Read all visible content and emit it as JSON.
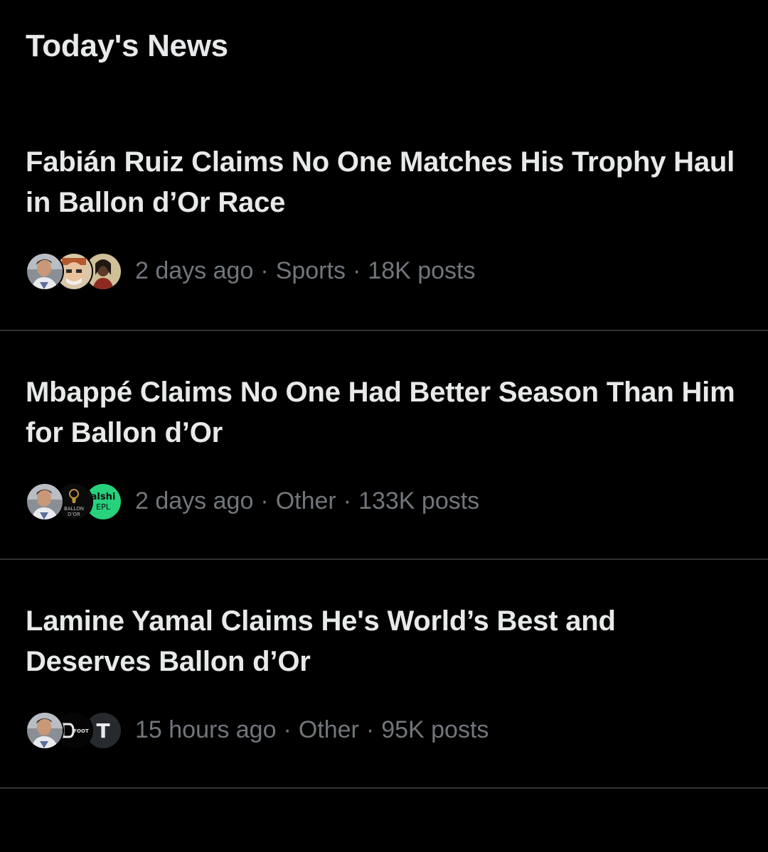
{
  "section": {
    "title": "Today's News"
  },
  "news": [
    {
      "headline": "Fabián Ruiz Claims No One Matches His Trophy Haul in Ballon d’Or Race",
      "time": "2 days ago",
      "category": "Sports",
      "posts": "18K posts",
      "avatars": [
        "man-avatar",
        "painted-portrait-avatar",
        "woman-avatar"
      ]
    },
    {
      "headline": "Mbappé Claims No One Had Better Season Than Him for Ballon d’Or",
      "time": "2 days ago",
      "category": "Other",
      "posts": "133K posts",
      "avatars": [
        "man-avatar",
        "ballon-dor-avatar",
        "kalshi-epl-avatar"
      ],
      "avatar_text": {
        "ballon": "BALLON",
        "dor": "D'OR",
        "kalshi": "alshi",
        "epl": "EPL"
      }
    },
    {
      "headline": "Lamine Yamal Claims He's World’s Best and Deserves Ballon d’Or",
      "time": "15 hours ago",
      "category": "Other",
      "posts": "95K posts",
      "avatars": [
        "man-avatar",
        "foot-logo-avatar",
        "t-logo-avatar"
      ],
      "avatar_text": {
        "foot": "FOOT",
        "t": "T"
      }
    }
  ],
  "separator": "·",
  "colors": {
    "background": "#000000",
    "text_primary": "#e7e9ea",
    "text_secondary": "#71767b",
    "divider": "#2f3336",
    "kalshi_green": "#28d17c"
  }
}
